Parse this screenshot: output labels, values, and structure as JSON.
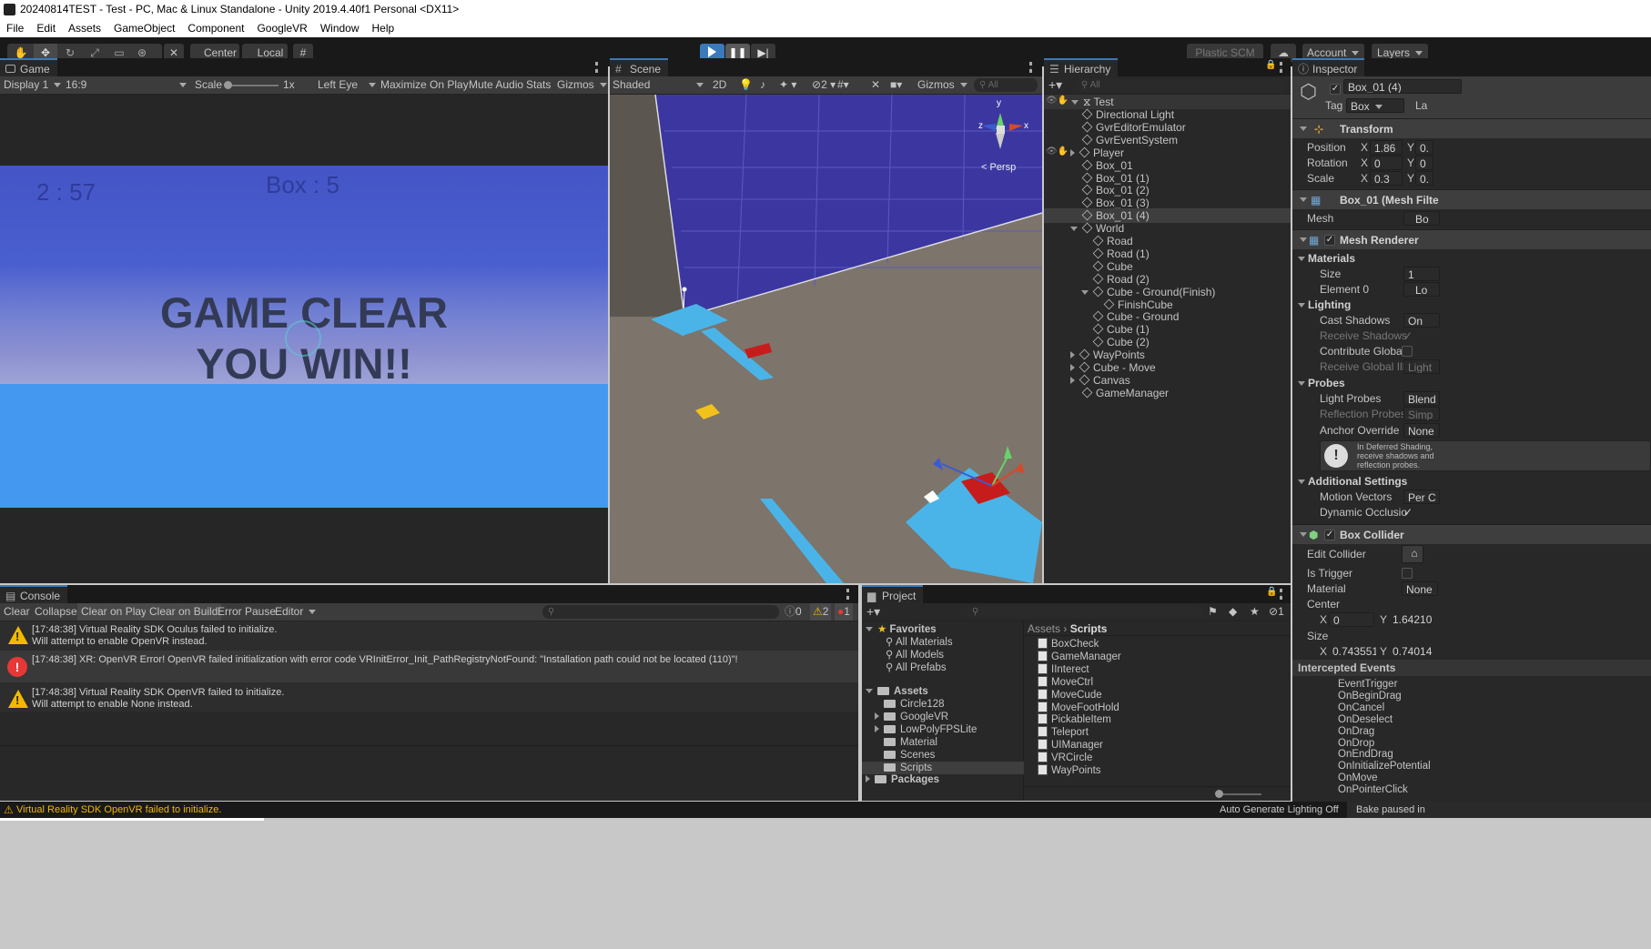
{
  "window": {
    "title": "20240814TEST - Test - PC, Mac & Linux Standalone - Unity 2019.4.40f1 Personal <DX11>"
  },
  "menu": [
    "File",
    "Edit",
    "Assets",
    "GameObject",
    "Component",
    "GoogleVR",
    "Window",
    "Help"
  ],
  "toolbar": {
    "center": "Center",
    "local": "Local",
    "plastic": "Plastic SCM",
    "account": "Account",
    "layers": "Layers"
  },
  "game": {
    "tab": "Game",
    "display": "Display 1",
    "aspect": "16:9",
    "scale_label": "Scale",
    "scale_value": "1x",
    "eye": "Left Eye",
    "maximize": "Maximize On Play",
    "mute": "Mute Audio",
    "stats": "Stats",
    "gizmos": "Gizmos",
    "timer": "2 : 57",
    "box_count": "Box : 5",
    "clear_line1": "GAME CLEAR",
    "clear_line2": "YOU WIN!!"
  },
  "scene": {
    "tab": "Scene",
    "shading": "Shaded",
    "twod": "2D",
    "hidden_count": "2",
    "gizmos": "Gizmos",
    "search_placeholder": "All",
    "persp": "< Persp",
    "axis_y": "y",
    "axis_x": "x",
    "axis_z": "z"
  },
  "hierarchy": {
    "tab": "Hierarchy",
    "search_placeholder": "All",
    "scene": "Test",
    "items": [
      {
        "label": "Directional Light",
        "depth": 1
      },
      {
        "label": "GvrEditorEmulator",
        "depth": 1
      },
      {
        "label": "GvrEventSystem",
        "depth": 1
      },
      {
        "label": "Player",
        "depth": 1,
        "fold": "closed"
      },
      {
        "label": "Box_01",
        "depth": 1
      },
      {
        "label": "Box_01 (1)",
        "depth": 1
      },
      {
        "label": "Box_01 (2)",
        "depth": 1
      },
      {
        "label": "Box_01 (3)",
        "depth": 1
      },
      {
        "label": "Box_01 (4)",
        "depth": 1,
        "selected": true
      },
      {
        "label": "World",
        "depth": 1,
        "fold": "open"
      },
      {
        "label": "Road",
        "depth": 2
      },
      {
        "label": "Road (1)",
        "depth": 2
      },
      {
        "label": "Cube",
        "depth": 2
      },
      {
        "label": "Road (2)",
        "depth": 2
      },
      {
        "label": "Cube - Ground(Finish)",
        "depth": 2,
        "fold": "open"
      },
      {
        "label": "FinishCube",
        "depth": 3
      },
      {
        "label": "Cube - Ground",
        "depth": 2
      },
      {
        "label": "Cube (1)",
        "depth": 2
      },
      {
        "label": "Cube (2)",
        "depth": 2
      },
      {
        "label": "WayPoints",
        "depth": 1,
        "fold": "closed"
      },
      {
        "label": "Cube - Move",
        "depth": 1,
        "fold": "closed"
      },
      {
        "label": "Canvas",
        "depth": 1,
        "fold": "closed"
      },
      {
        "label": "GameManager",
        "depth": 1
      }
    ]
  },
  "inspector": {
    "tab": "Inspector",
    "name": "Box_01 (4)",
    "tag_label": "Tag",
    "tag_value": "Box",
    "layer_label": "La",
    "transform": {
      "title": "Transform",
      "position": "Position",
      "rotation": "Rotation",
      "scale": "Scale",
      "px": "1.86",
      "rx": "0",
      "sx": "0.3",
      "py": "0.",
      "ry": "0",
      "sy": "0."
    },
    "mesh_filter": {
      "title": "Box_01 (Mesh Filte",
      "mesh_label": "Mesh",
      "mesh_value": "Bo"
    },
    "mesh_renderer": {
      "title": "Mesh Renderer",
      "materials": "Materials",
      "size": "Size",
      "size_value": "1",
      "element0": "Element 0",
      "element0_value": "Lo",
      "lighting": "Lighting",
      "cast": "Cast Shadows",
      "cast_value": "On",
      "receive": "Receive Shadows",
      "contribute": "Contribute Global I",
      "receive_gi": "Receive Global Illu",
      "receive_gi_value": "Light",
      "probes": "Probes",
      "light_probes": "Light Probes",
      "light_probes_value": "Blend",
      "reflection": "Reflection Probes",
      "reflection_value": "Simp",
      "anchor": "Anchor Override",
      "anchor_value": "None",
      "info_line1": "In Deferred Shading,",
      "info_line2": "receive shadows and",
      "info_line3": "reflection probes.",
      "additional": "Additional Settings",
      "motion": "Motion Vectors",
      "motion_value": "Per C",
      "dynamic": "Dynamic Occlusio"
    },
    "box_collider": {
      "title": "Box Collider",
      "edit": "Edit Collider",
      "trigger": "Is Trigger",
      "material": "Material",
      "material_value": "None",
      "center": "Center",
      "cx": "0",
      "cy": "1.64210",
      "size": "Size",
      "szx": "0.743551",
      "szy": "0.74014"
    },
    "events": {
      "title": "Intercepted Events",
      "items": [
        "EventTrigger",
        "OnBeginDrag",
        "OnCancel",
        "OnDeselect",
        "OnDrag",
        "OnDrop",
        "OnEndDrag",
        "OnInitializePotential",
        "OnMove",
        "OnPointerClick"
      ]
    }
  },
  "console": {
    "tab": "Console",
    "buttons": [
      "Clear",
      "Collapse",
      "Clear on Play",
      "Clear on Build",
      "Error Pause",
      "Editor"
    ],
    "count_info": "0",
    "count_warn": "2",
    "count_err": "1",
    "messages": [
      {
        "type": "warning",
        "line1": "[17:48:38] Virtual Reality SDK Oculus failed to initialize.",
        "line2": "Will attempt to enable OpenVR instead."
      },
      {
        "type": "error",
        "line1": "[17:48:38] XR: OpenVR Error! OpenVR failed initialization with error code VRInitError_Init_PathRegistryNotFound: \"Installation path could not be located (110)\"!",
        "line2": ""
      },
      {
        "type": "warning",
        "line1": "[17:48:38] Virtual Reality SDK OpenVR failed to initialize.",
        "line2": "Will attempt to enable None instead."
      }
    ]
  },
  "project": {
    "tab": "Project",
    "hidden_count": "1",
    "favorites": "Favorites",
    "fav_items": [
      "All Materials",
      "All Models",
      "All Prefabs"
    ],
    "assets": "Assets",
    "asset_folders": [
      {
        "label": "Circle128",
        "fold": false
      },
      {
        "label": "GoogleVR",
        "fold": true
      },
      {
        "label": "LowPolyFPSLite",
        "fold": true
      },
      {
        "label": "Material",
        "fold": false
      },
      {
        "label": "Scenes",
        "fold": false
      },
      {
        "label": "Scripts",
        "fold": false
      }
    ],
    "packages": "Packages",
    "breadcrumb_root": "Assets",
    "breadcrumb_current": "Scripts",
    "scripts": [
      "BoxCheck",
      "GameManager",
      "IInterect",
      "MoveCtrl",
      "MoveCude",
      "MoveFootHold",
      "PickableItem",
      "Teleport",
      "UIManager",
      "VRCircle",
      "WayPoints"
    ]
  },
  "status": {
    "message": "Virtual Reality SDK OpenVR failed to initialize.",
    "auto_lighting": "Auto Generate Lighting Off",
    "bake": "Bake paused in"
  },
  "colors": {
    "accent": "#3a79bb",
    "warning": "#f2b900",
    "error": "#e73737",
    "game_sky": "#4758c8",
    "game_floor": "#4598f0",
    "scene_ground": "#7d746b"
  }
}
